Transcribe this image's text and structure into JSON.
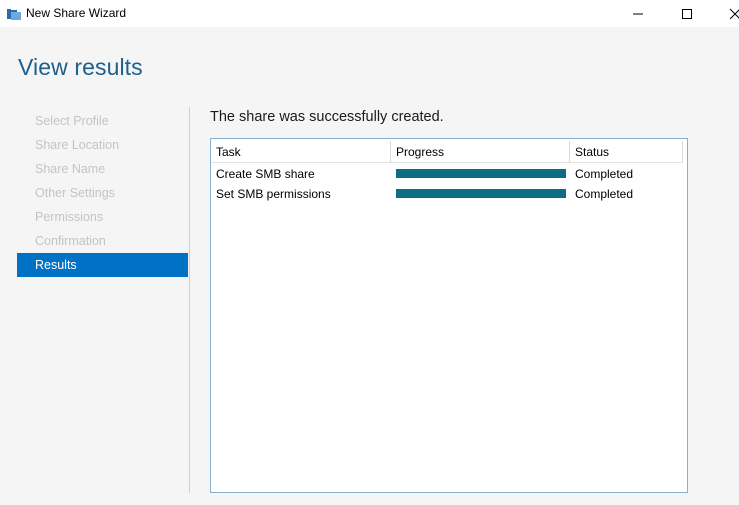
{
  "window": {
    "title": "New Share Wizard",
    "icon": "share-folder-icon"
  },
  "page": {
    "title": "View results",
    "message": "The share was successfully created."
  },
  "nav": {
    "items": [
      {
        "label": "Select Profile",
        "active": false
      },
      {
        "label": "Share Location",
        "active": false
      },
      {
        "label": "Share Name",
        "active": false
      },
      {
        "label": "Other Settings",
        "active": false
      },
      {
        "label": "Permissions",
        "active": false
      },
      {
        "label": "Confirmation",
        "active": false
      },
      {
        "label": "Results",
        "active": true
      }
    ]
  },
  "table": {
    "columns": [
      "Task",
      "Progress",
      "Status"
    ],
    "rows": [
      {
        "task": "Create SMB share",
        "progress": 1.0,
        "status": "Completed"
      },
      {
        "task": "Set SMB permissions",
        "progress": 1.0,
        "status": "Completed"
      }
    ]
  },
  "colors": {
    "accent": "#0072c6",
    "title": "#1e5f8e",
    "progress_fill": "#0b6e82"
  }
}
